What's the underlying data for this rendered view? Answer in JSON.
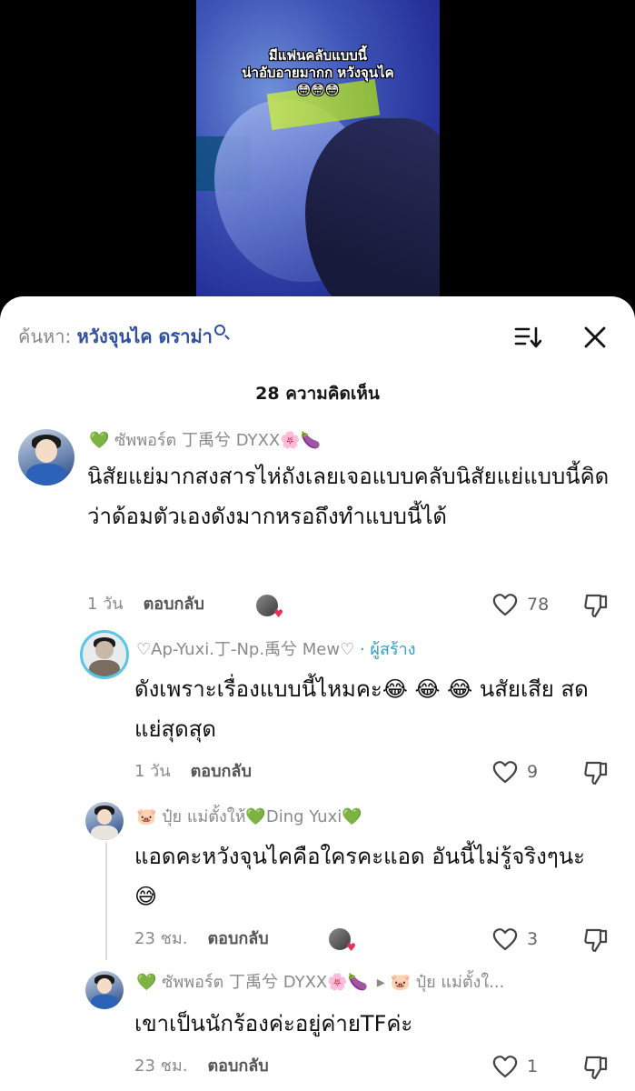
{
  "video": {
    "caption_line1": "มีแฟนคลับแบบนี้",
    "caption_line2": "น่าอับอายมากก หวังจุนไค",
    "caption_emojis": "😳😳😳"
  },
  "search": {
    "prefix": "ค้นหา:",
    "term": "หวังจุนไค ดราม่า"
  },
  "header": {
    "comment_count": "28 ความคิดเห็น"
  },
  "comments": [
    {
      "username": "💚 ซัพพอร์ต 丁禹兮 DYXX🌸🍆",
      "text": "นิสัยแย่มากสงสารไห่ถังเลยเจอแบบคลับนิสัยแย่แบบนี้คิดว่าด้อมตัวเองดังมากหรอถึงทำแบบนี้ได้",
      "time": "1 วัน",
      "reply_label": "ตอบกลับ",
      "likes": "78"
    },
    {
      "username": "♡Ap-Yuxi.丁-Np.禹兮 Mew♡",
      "creator_tag": "· ผู้สร้าง",
      "text": "ดังเพราะเรื่องแบบนี้ไหมคะ😂 😂 😂 นสัยเสีย สด แย่สุดสุด",
      "time": "1 วัน",
      "reply_label": "ตอบกลับ",
      "likes": "9"
    },
    {
      "username": "🐷 ปุ๋ย แม่ตั้งให้💚Ding Yuxi💚",
      "text": "แอดคะหวังจุนไคคือใครคะแอด อันนี้ไม่รู้จริงๆนะ😅",
      "time": "23 ชม.",
      "reply_label": "ตอบกลับ",
      "likes": "3"
    },
    {
      "username": "💚 ซัพพอร์ต 丁禹兮 DYXX🌸🍆",
      "reply_to": "▸ 🐷 ปุ๋ย แม่ตั้งใ...",
      "text": "เขาเป็นนักร้องค่ะอยู่ค่ายTFค่ะ",
      "time": "23 ชม.",
      "reply_label": "ตอบกลับ",
      "likes": "1"
    }
  ],
  "icons": {
    "sort": "sort-icon",
    "close": "close-icon",
    "like": "heart-icon",
    "dislike": "thumbs-down-icon"
  },
  "colors": {
    "search_term": "#2f4fa3",
    "creator_tag": "#2f9fc8",
    "sheet_bg": "#ffffff"
  }
}
